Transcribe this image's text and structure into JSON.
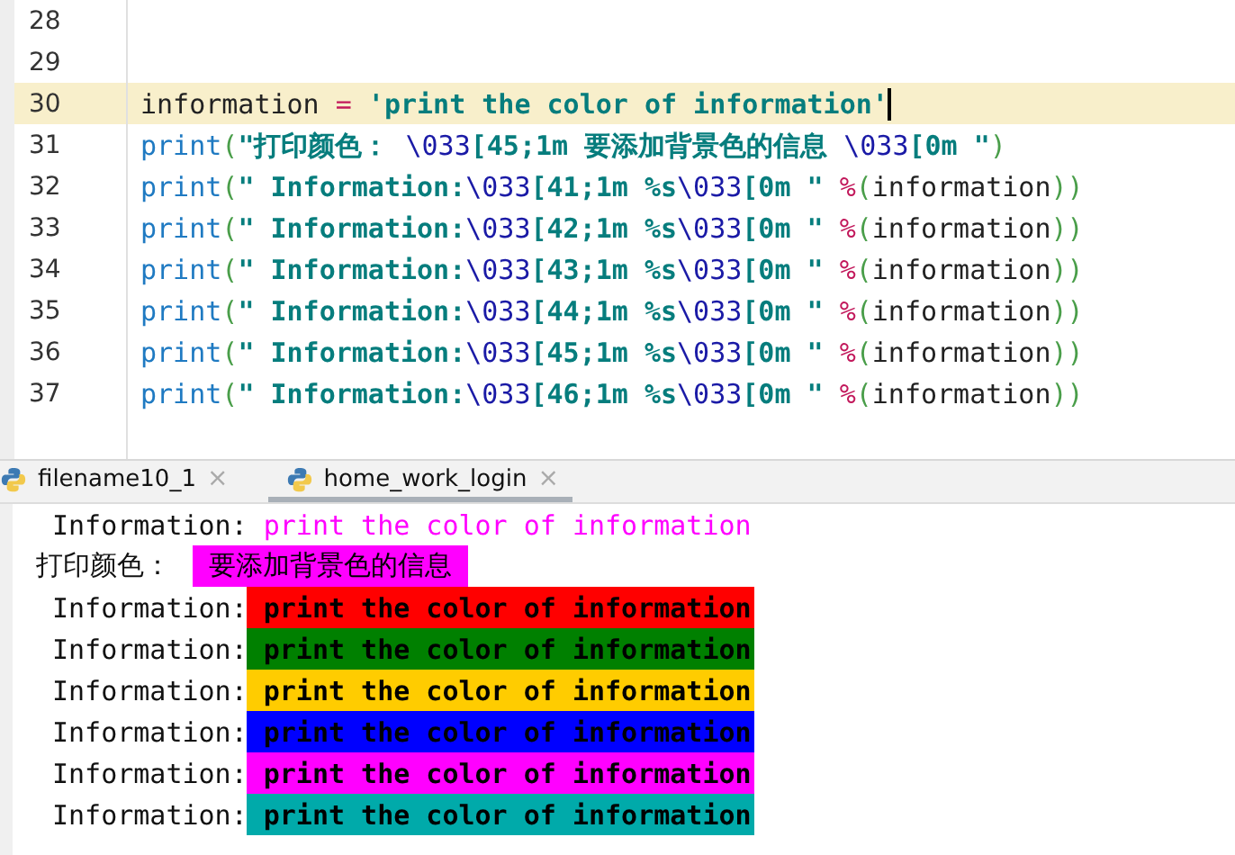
{
  "editor": {
    "lines": [
      {
        "number": "28",
        "current": false
      },
      {
        "number": "29",
        "current": false
      },
      {
        "number": "30",
        "current": true,
        "segments": [
          {
            "text": "information ",
            "kind": "ident"
          },
          {
            "text": "=",
            "kind": "op"
          },
          {
            "text": " 'print the color of information'",
            "kind": "string"
          }
        ]
      },
      {
        "number": "31",
        "current": false,
        "segments": [
          {
            "text": "print",
            "kind": "builtin"
          },
          {
            "text": "(",
            "kind": "paren"
          },
          {
            "text": "\"打印颜色： ",
            "kind": "string"
          },
          {
            "text": "\\033",
            "kind": "escape"
          },
          {
            "text": "[45;1m 要添加背景色的信息 ",
            "kind": "string"
          },
          {
            "text": "\\033",
            "kind": "escape"
          },
          {
            "text": "[0m \"",
            "kind": "string"
          },
          {
            "text": ")",
            "kind": "paren"
          }
        ]
      },
      {
        "number": "32",
        "current": false,
        "segments": [
          {
            "text": "print",
            "kind": "builtin"
          },
          {
            "text": "(",
            "kind": "paren"
          },
          {
            "text": "\" Information:",
            "kind": "string"
          },
          {
            "text": "\\033",
            "kind": "escape"
          },
          {
            "text": "[41;1m %s",
            "kind": "string"
          },
          {
            "text": "\\033",
            "kind": "escape"
          },
          {
            "text": "[0m \" ",
            "kind": "string"
          },
          {
            "text": "%",
            "kind": "op"
          },
          {
            "text": "(",
            "kind": "paren"
          },
          {
            "text": "information",
            "kind": "ident"
          },
          {
            "text": "))",
            "kind": "paren"
          }
        ]
      },
      {
        "number": "33",
        "current": false,
        "segments": [
          {
            "text": "print",
            "kind": "builtin"
          },
          {
            "text": "(",
            "kind": "paren"
          },
          {
            "text": "\" Information:",
            "kind": "string"
          },
          {
            "text": "\\033",
            "kind": "escape"
          },
          {
            "text": "[42;1m %s",
            "kind": "string"
          },
          {
            "text": "\\033",
            "kind": "escape"
          },
          {
            "text": "[0m \" ",
            "kind": "string"
          },
          {
            "text": "%",
            "kind": "op"
          },
          {
            "text": "(",
            "kind": "paren"
          },
          {
            "text": "information",
            "kind": "ident"
          },
          {
            "text": "))",
            "kind": "paren"
          }
        ]
      },
      {
        "number": "34",
        "current": false,
        "segments": [
          {
            "text": "print",
            "kind": "builtin"
          },
          {
            "text": "(",
            "kind": "paren"
          },
          {
            "text": "\" Information:",
            "kind": "string"
          },
          {
            "text": "\\033",
            "kind": "escape"
          },
          {
            "text": "[43;1m %s",
            "kind": "string"
          },
          {
            "text": "\\033",
            "kind": "escape"
          },
          {
            "text": "[0m \" ",
            "kind": "string"
          },
          {
            "text": "%",
            "kind": "op"
          },
          {
            "text": "(",
            "kind": "paren"
          },
          {
            "text": "information",
            "kind": "ident"
          },
          {
            "text": "))",
            "kind": "paren"
          }
        ]
      },
      {
        "number": "35",
        "current": false,
        "segments": [
          {
            "text": "print",
            "kind": "builtin"
          },
          {
            "text": "(",
            "kind": "paren"
          },
          {
            "text": "\" Information:",
            "kind": "string"
          },
          {
            "text": "\\033",
            "kind": "escape"
          },
          {
            "text": "[44;1m %s",
            "kind": "string"
          },
          {
            "text": "\\033",
            "kind": "escape"
          },
          {
            "text": "[0m \" ",
            "kind": "string"
          },
          {
            "text": "%",
            "kind": "op"
          },
          {
            "text": "(",
            "kind": "paren"
          },
          {
            "text": "information",
            "kind": "ident"
          },
          {
            "text": "))",
            "kind": "paren"
          }
        ]
      },
      {
        "number": "36",
        "current": false,
        "segments": [
          {
            "text": "print",
            "kind": "builtin"
          },
          {
            "text": "(",
            "kind": "paren"
          },
          {
            "text": "\" Information:",
            "kind": "string"
          },
          {
            "text": "\\033",
            "kind": "escape"
          },
          {
            "text": "[45;1m %s",
            "kind": "string"
          },
          {
            "text": "\\033",
            "kind": "escape"
          },
          {
            "text": "[0m \" ",
            "kind": "string"
          },
          {
            "text": "%",
            "kind": "op"
          },
          {
            "text": "(",
            "kind": "paren"
          },
          {
            "text": "information",
            "kind": "ident"
          },
          {
            "text": "))",
            "kind": "paren"
          }
        ]
      },
      {
        "number": "37",
        "current": false,
        "segments": [
          {
            "text": "print",
            "kind": "builtin"
          },
          {
            "text": "(",
            "kind": "paren"
          },
          {
            "text": "\" Information:",
            "kind": "string"
          },
          {
            "text": "\\033",
            "kind": "escape"
          },
          {
            "text": "[46;1m %s",
            "kind": "string"
          },
          {
            "text": "\\033",
            "kind": "escape"
          },
          {
            "text": "[0m \" ",
            "kind": "string"
          },
          {
            "text": "%",
            "kind": "op"
          },
          {
            "text": "(",
            "kind": "paren"
          },
          {
            "text": "information",
            "kind": "ident"
          },
          {
            "text": "))",
            "kind": "paren"
          }
        ]
      }
    ]
  },
  "run_tabs": [
    {
      "label": "filename10_1",
      "close": "×",
      "selected": false
    },
    {
      "label": "home_work_login",
      "close": "×",
      "selected": true
    }
  ],
  "console": {
    "lines": [
      {
        "kind": "fg",
        "label": "Information:",
        "text": "print the color of information",
        "color": "#ff00ff"
      },
      {
        "kind": "heading",
        "label": "打印颜色：",
        "text": "要添加背景色的信息",
        "color": "#ff00ff"
      },
      {
        "kind": "bg",
        "label": "Information:",
        "text": "print the color of information",
        "color": "#ff0000"
      },
      {
        "kind": "bg",
        "label": "Information:",
        "text": "print the color of information",
        "color": "#008000"
      },
      {
        "kind": "bg",
        "label": "Information:",
        "text": "print the color of information",
        "color": "#ffcc00"
      },
      {
        "kind": "bg",
        "label": "Information:",
        "text": "print the color of information",
        "color": "#0000ff"
      },
      {
        "kind": "bg",
        "label": "Information:",
        "text": "print the color of information",
        "color": "#ff00ff"
      },
      {
        "kind": "bg",
        "label": "Information:",
        "text": "print the color of information",
        "color": "#00aaaa"
      }
    ]
  }
}
